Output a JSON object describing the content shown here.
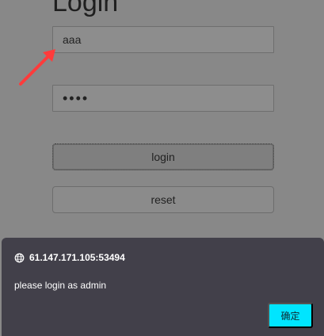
{
  "page": {
    "title": "Login"
  },
  "form": {
    "username_value": "aaa",
    "password_value": "••••",
    "login_label": "login",
    "reset_label": "reset"
  },
  "dialog": {
    "origin": "61.147.171.105:53494",
    "message": "please login as admin",
    "ok_label": "确定"
  },
  "icons": {
    "origin": "globe-icon",
    "annotation": "arrow-icon"
  },
  "colors": {
    "page_overlay": "#888888",
    "dialog_background": "#42404a",
    "dialog_button": "#00e5ff",
    "annotation_arrow": "#ff3b3b"
  }
}
